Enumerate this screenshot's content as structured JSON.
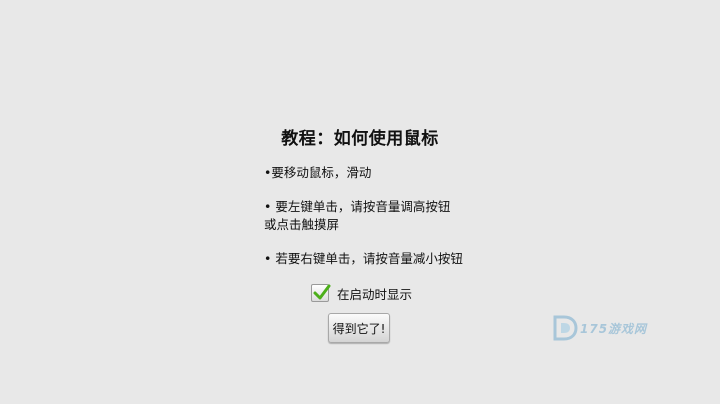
{
  "dialog": {
    "title": "教程：如何使用鼠标",
    "tips": [
      "•要移动鼠标，滑动",
      "• 要左键单击，请按音量调高按钮\n或点击触摸屏",
      "• 若要右键单击，请按音量减小按钮"
    ],
    "checkbox": {
      "label": "在启动时显示",
      "checked": true
    },
    "ok_button": "得到它了!"
  },
  "watermark": {
    "text": "175游戏网",
    "icon": "d-logo-icon"
  },
  "colors": {
    "background": "#e8e8e8",
    "check": "#4caf1a",
    "watermark": "#5b9fc9"
  }
}
